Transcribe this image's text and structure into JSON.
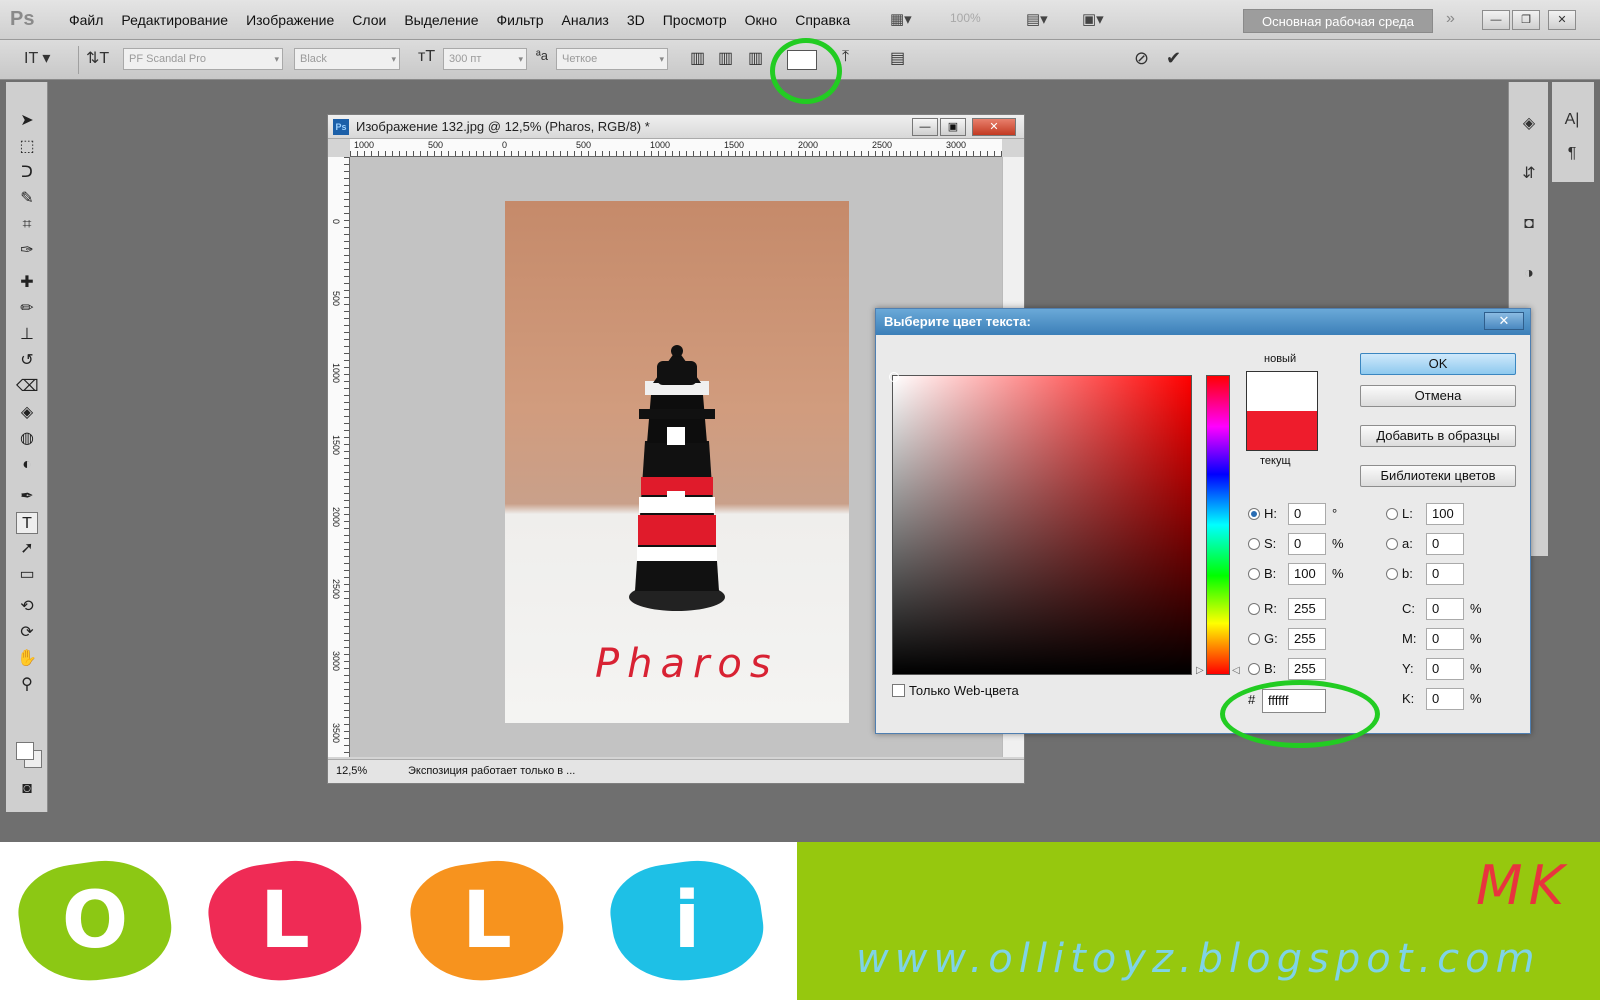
{
  "app": {
    "logo": "Ps",
    "menus": [
      "Файл",
      "Редактирование",
      "Изображение",
      "Слои",
      "Выделение",
      "Фильтр",
      "Анализ",
      "3D",
      "Просмотр",
      "Окно",
      "Справка"
    ],
    "zoom": "100%",
    "workspace": "Основная рабочая среда"
  },
  "options": {
    "font_family": "PF Scandal Pro",
    "font_style": "Black",
    "font_size": "300 пт",
    "antialias": "Четкое",
    "text_color": "#ffffff"
  },
  "document": {
    "title": "Изображение 132.jpg @ 12,5% (Pharos, RGB/8) *",
    "ruler_h": [
      "1000",
      "500",
      "0",
      "500",
      "1000",
      "1500",
      "2000",
      "2500",
      "3000"
    ],
    "ruler_v": [
      "0",
      "500",
      "1000",
      "1500",
      "2000",
      "2500",
      "3000",
      "3500"
    ],
    "zoom": "12,5%",
    "status": "Экспозиция работает только в ...",
    "photo_text": "Pharos"
  },
  "picker": {
    "title": "Выберите цвет текста:",
    "new_label": "новый",
    "current_label": "текущ",
    "new_color": "#ffffff",
    "current_color": "#ee1c2c",
    "buttons": {
      "ok": "OK",
      "cancel": "Отмена",
      "add_swatch": "Добавить в образцы",
      "libraries": "Библиотеки цветов"
    },
    "hsb": [
      {
        "label": "H:",
        "value": "0",
        "unit": "°"
      },
      {
        "label": "S:",
        "value": "0",
        "unit": "%"
      },
      {
        "label": "B:",
        "value": "100",
        "unit": "%"
      }
    ],
    "rgb": [
      {
        "label": "R:",
        "value": "255"
      },
      {
        "label": "G:",
        "value": "255"
      },
      {
        "label": "B:",
        "value": "255"
      }
    ],
    "lab": [
      {
        "label": "L:",
        "value": "100"
      },
      {
        "label": "a:",
        "value": "0"
      },
      {
        "label": "b:",
        "value": "0"
      }
    ],
    "cmyk": [
      {
        "label": "C:",
        "value": "0",
        "unit": "%"
      },
      {
        "label": "M:",
        "value": "0",
        "unit": "%"
      },
      {
        "label": "Y:",
        "value": "0",
        "unit": "%"
      },
      {
        "label": "K:",
        "value": "0",
        "unit": "%"
      }
    ],
    "web_only": "Только Web-цвета",
    "hex_symbol": "#",
    "hex": "ffffff"
  },
  "banner": {
    "letters": [
      "O",
      "L",
      "L",
      "i"
    ],
    "letter_colors": [
      "#8cc814",
      "#ef2b55",
      "#f7931e",
      "#1ec0e6"
    ],
    "mk": "MK",
    "site": "www.ollitoyz.blogspot.com"
  }
}
